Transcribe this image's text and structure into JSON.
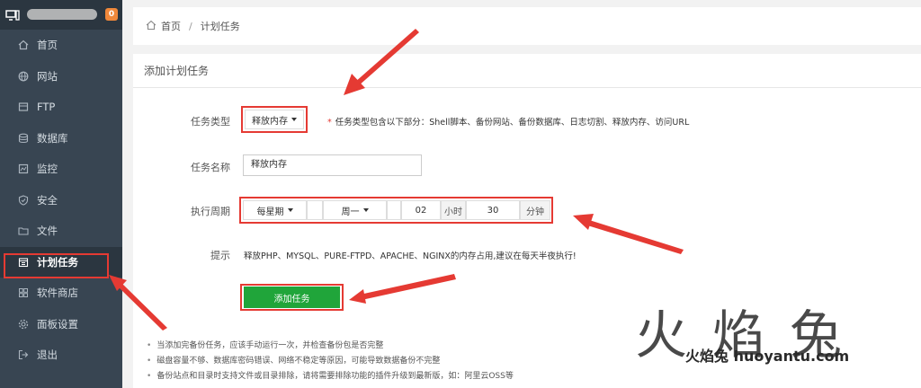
{
  "sidebar": {
    "badge": "0",
    "items": [
      {
        "label": "首页",
        "icon": "home-icon"
      },
      {
        "label": "网站",
        "icon": "globe-icon"
      },
      {
        "label": "FTP",
        "icon": "ftp-icon"
      },
      {
        "label": "数据库",
        "icon": "database-icon"
      },
      {
        "label": "监控",
        "icon": "monitor-icon"
      },
      {
        "label": "安全",
        "icon": "shield-icon"
      },
      {
        "label": "文件",
        "icon": "folder-icon"
      },
      {
        "label": "计划任务",
        "icon": "calendar-icon"
      },
      {
        "label": "软件商店",
        "icon": "grid-icon"
      },
      {
        "label": "面板设置",
        "icon": "gear-icon"
      },
      {
        "label": "退出",
        "icon": "logout-icon"
      }
    ]
  },
  "breadcrumb": {
    "home": "首页",
    "sep": "/",
    "current": "计划任务"
  },
  "panel_title": "添加计划任务",
  "form": {
    "type_label": "任务类型",
    "type_value": "释放内存",
    "type_hint": "任务类型包含以下部分：Shell脚本、备份网站、备份数据库、日志切割、释放内存、访问URL",
    "name_label": "任务名称",
    "name_value": "释放内存",
    "cycle_label": "执行周期",
    "cycle_period": "每星期",
    "cycle_weekday": "周一",
    "hour_value": "02",
    "hour_unit": "小时",
    "minute_value": "30",
    "minute_unit": "分钟",
    "tip_label": "提示",
    "tip_text": "释放PHP、MYSQL、PURE-FTPD、APACHE、NGINX的内存占用,建议在每天半夜执行!",
    "submit": "添加任务"
  },
  "notes": [
    "当添加完备份任务，应该手动运行一次，并检查备份包是否完整",
    "磁盘容量不够、数据库密码错误、网络不稳定等原因，可能导致数据备份不完整",
    "备份站点和目录时支持文件或目录排除，请将需要排除功能的插件升级到最新版，如：阿里云OSS等"
  ],
  "watermark": {
    "big": "火焰兔",
    "small": "火焰兔 huoyantu.com"
  },
  "colors": {
    "accent": "#20a53a",
    "highlight": "#e53a33",
    "sidebar": "#384552"
  }
}
